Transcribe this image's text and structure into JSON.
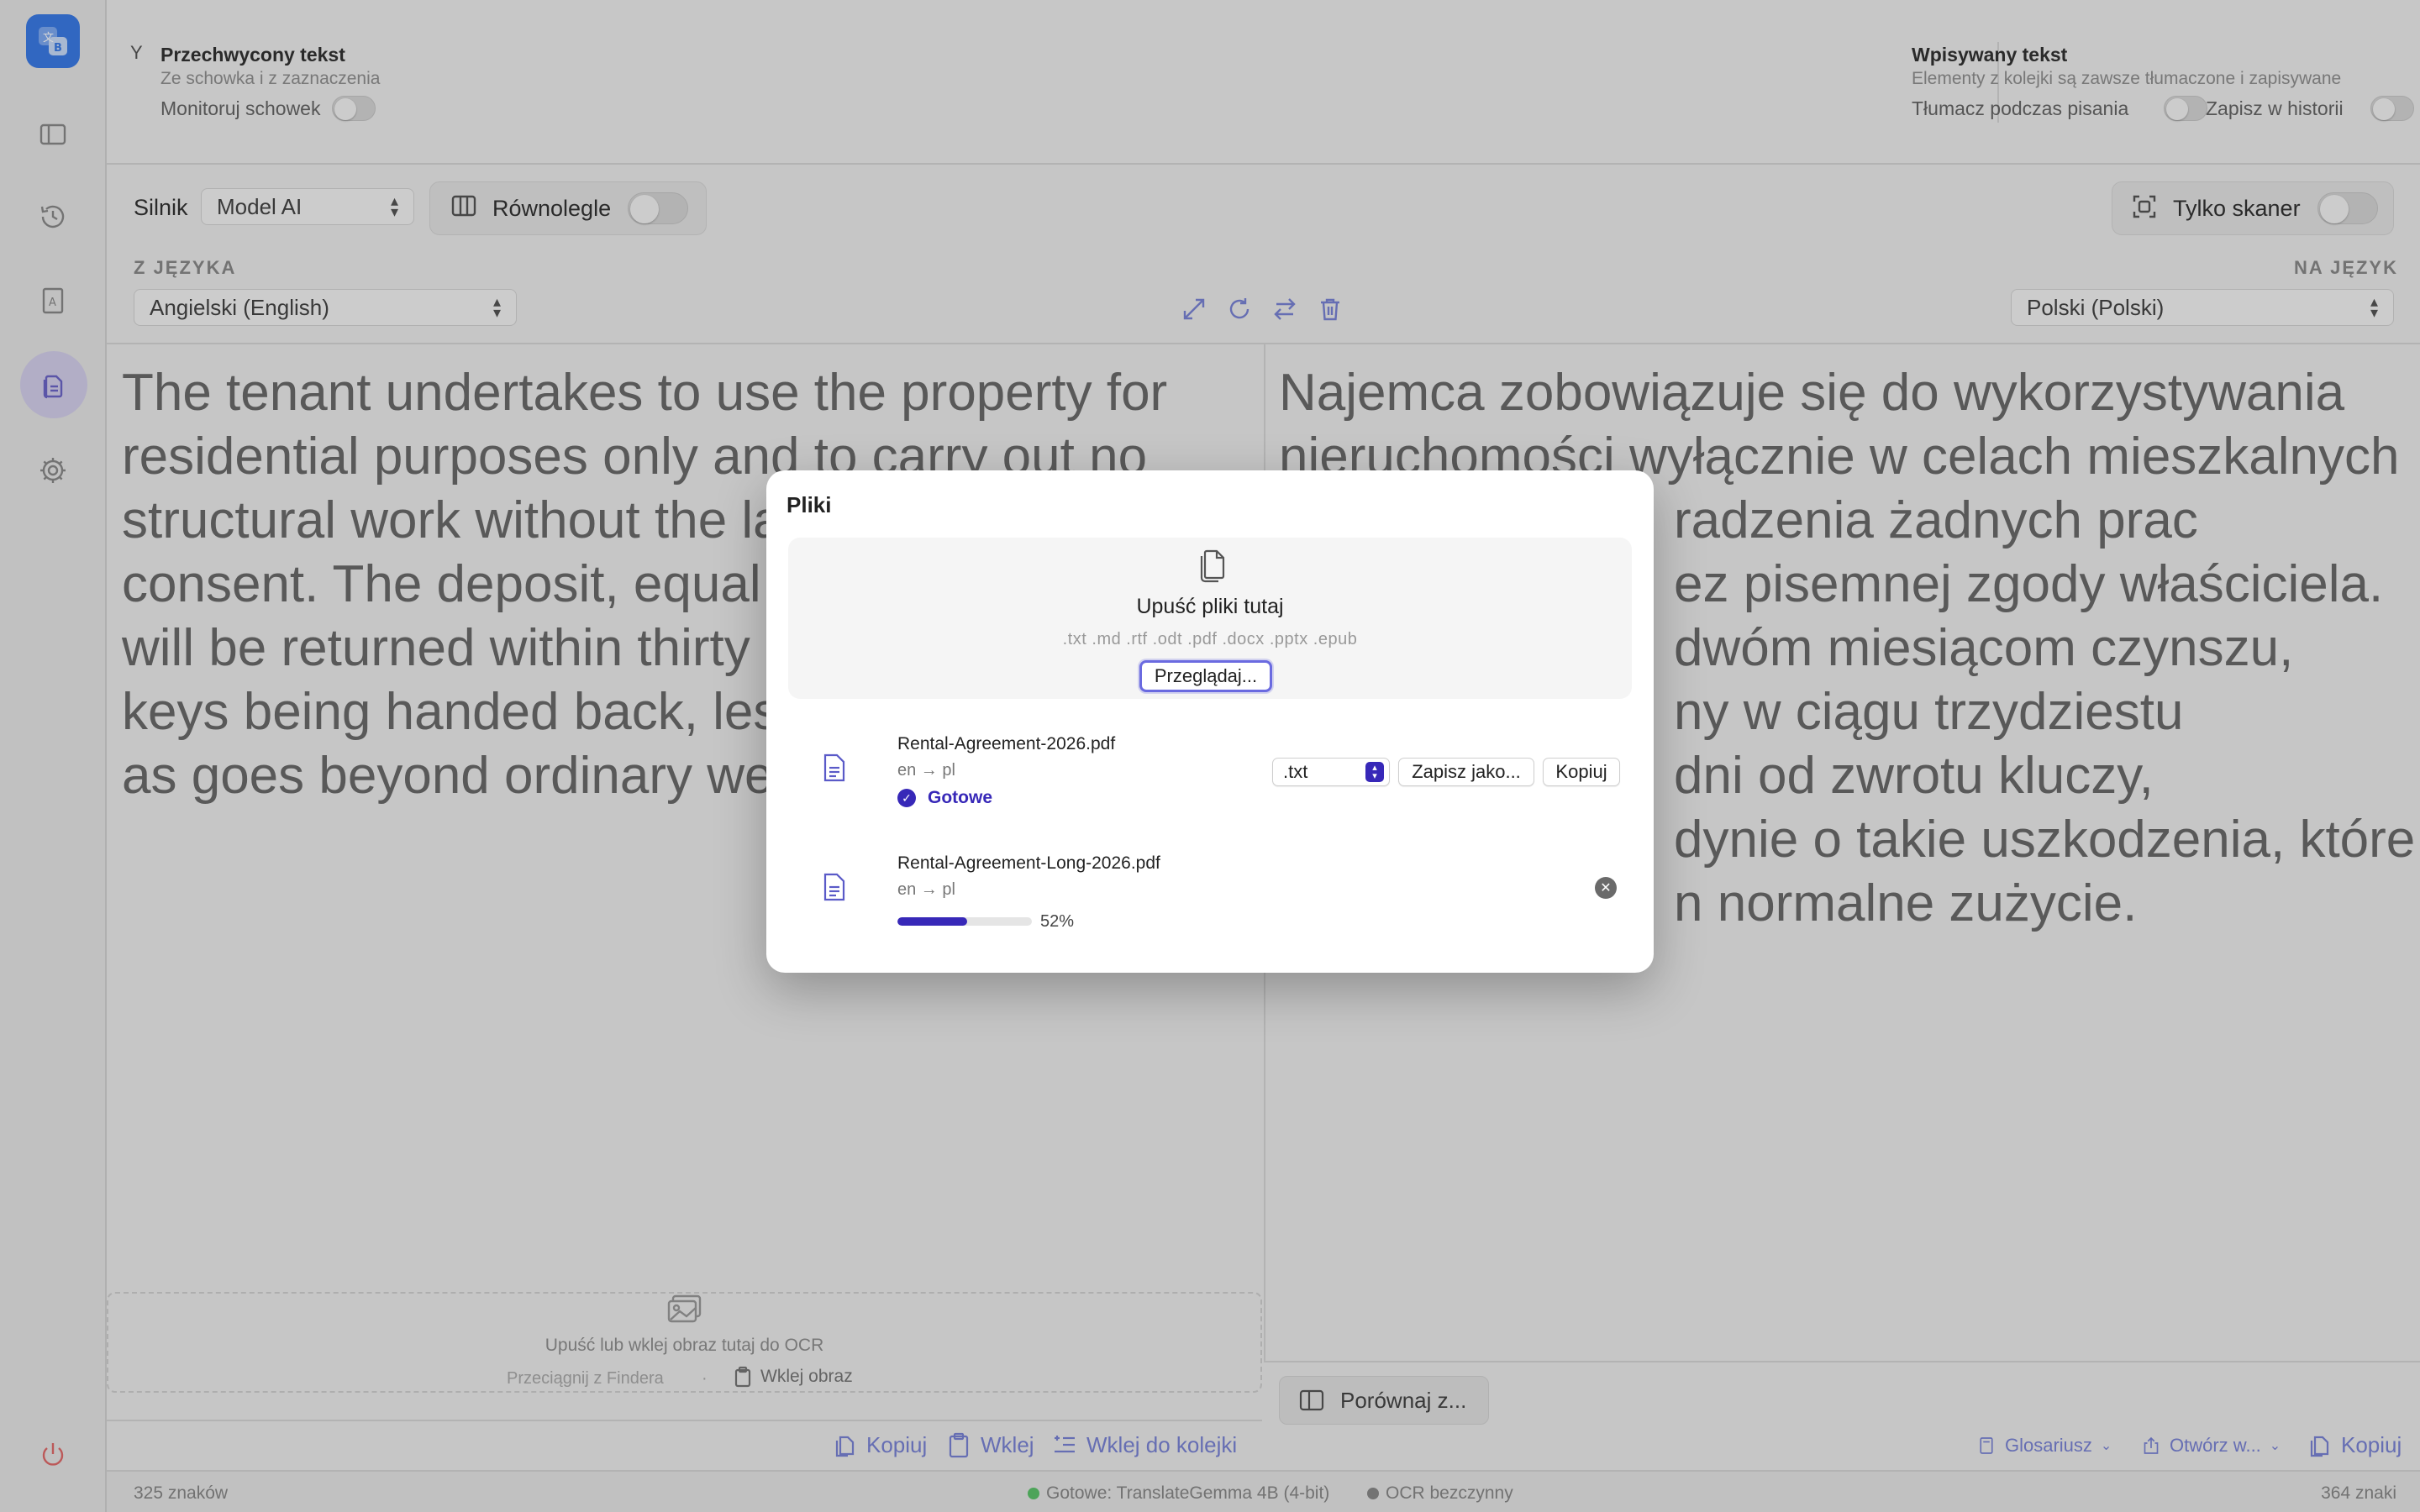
{
  "colors": {
    "accent": "#3728b8",
    "link": "#7a84d6",
    "ready_dot": "#5cc46a",
    "ocr_dot": "#8a8a8a"
  },
  "topbar": {
    "captured": {
      "title": "Przechwycony tekst",
      "subtitle": "Ze schowka i z zaznaczenia",
      "monitor_label": "Monitoruj schowek"
    },
    "typed": {
      "title": "Wpisywany tekst",
      "subtitle": "Elementy z kolejki są zawsze tłumaczone i zapisywane",
      "translate_label": "Tłumacz podczas pisania",
      "history_label": "Zapisz w historii"
    }
  },
  "toolbar": {
    "engine_label": "Silnik",
    "engine_value": "Model AI",
    "parallel_label": "Równolegle",
    "scanner_label": "Tylko skaner",
    "from_label": "Z JĘZYKA",
    "to_label": "NA JĘZYK",
    "from_value": "Angielski (English)",
    "to_value": "Polski (Polski)"
  },
  "source": {
    "lines": [
      "The tenant undertakes to use the property for",
      "residential purposes only and to carry out no",
      "structural work without the la",
      "consent. The deposit, equal t",
      "will be returned within thirty",
      "keys being handed back, les",
      "as goes beyond ordinary we"
    ]
  },
  "target": {
    "lines": [
      "Najemca zobowiązuje się do wykorzystywania",
      "nieruchomości wyłącznie w celach mieszkalnych",
      "radzenia żadnych prac",
      "ez pisemnej zgody właściciela.",
      "dwóm miesiącom czynszu,",
      "ny w ciągu trzydziestu",
      "dni od zwrotu kluczy,",
      "dynie o takie uszkodzenia, które",
      "n normalne zużycie."
    ]
  },
  "ocr": {
    "drop_text": "Upuść lub wklej obraz tutaj do OCR",
    "finder_text": "Przeciągnij z Findera",
    "paste_image": "Wklej obraz"
  },
  "left_actions": {
    "copy": "Kopiuj",
    "paste": "Wklej",
    "paste_queue": "Wklej do kolejki"
  },
  "right_actions": {
    "compare": "Porównaj z...",
    "glossary": "Glosariusz",
    "open_in": "Otwórz w...",
    "copy": "Kopiuj"
  },
  "status": {
    "left_count": "325 znaków",
    "engine_status": "Gotowe: TranslateGemma 4B (4-bit)",
    "ocr_status": "OCR bezczynny",
    "right_count": "364 znaki"
  },
  "dialog": {
    "title": "Pliki",
    "drop_label": "Upuść pliki tutaj",
    "formats": ".txt .md .rtf .odt .pdf .docx .pptx .epub",
    "browse": "Przeglądaj...",
    "files": [
      {
        "name": "Rental-Agreement-2026.pdf",
        "lang": "en → pl",
        "status": "Gotowe",
        "format": ".txt",
        "save_as": "Zapisz jako...",
        "copy": "Kopiuj"
      },
      {
        "name": "Rental-Agreement-Long-2026.pdf",
        "lang": "en → pl",
        "progress": 0.52,
        "progress_text": "52%"
      }
    ]
  }
}
